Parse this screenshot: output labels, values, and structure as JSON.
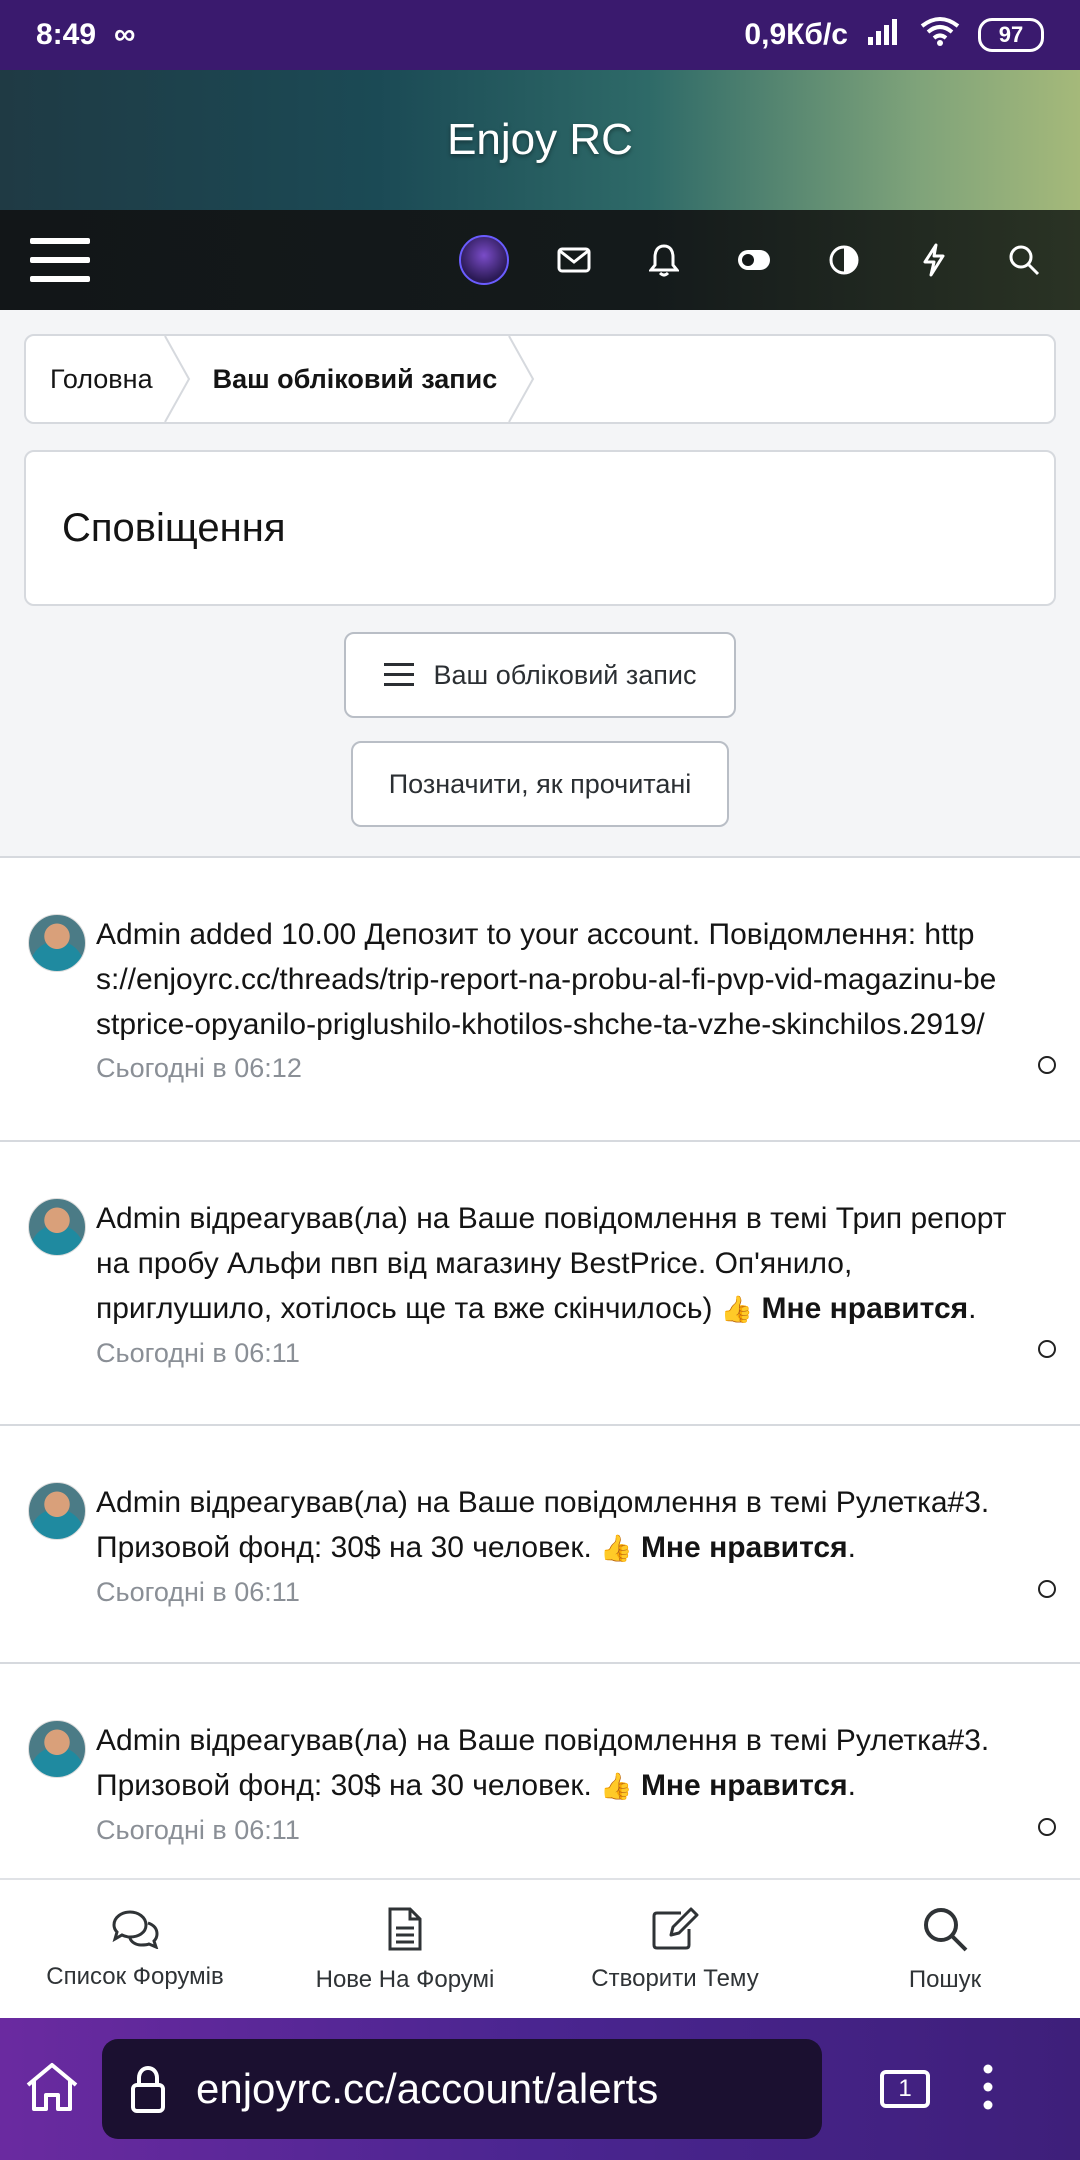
{
  "status_bar": {
    "time": "8:49",
    "infinity_icon": "∞",
    "network_speed": "0,9Кб/с",
    "battery": "97"
  },
  "header": {
    "site_title": "Enjoy RC"
  },
  "breadcrumb": {
    "home": "Головна",
    "current": "Ваш обліковий запис"
  },
  "page": {
    "title": "Сповіщення",
    "account_button": "Ваш обліковий запис",
    "mark_read_button": "Позначити, як прочитані"
  },
  "alerts": [
    {
      "text": "Admin added 10.00 Депозит to your account. Повідомлення: https://enjoyrc.cc/threads/trip-report-na-probu-al-fi-pvp-vid-magazinu-bestprice-opyanilo-priglushilo-khotilos-shche-ta-vzhe-skinchilos.2919/",
      "time": "Сьогодні в 06:12"
    },
    {
      "text": "Admin відреагував(ла) на Ваше повідомлення в темі Трип репорт на пробу Альфи пвп від магазину BestPrice. Оп'янило, приглушило, хотілось ще та вже скінчилось)",
      "reaction": "Мне нравится",
      "time": "Сьогодні в 06:11"
    },
    {
      "text": "Admin відреагував(ла) на Ваше повідомлення в темі Рулетка#3. Призовой фонд: 30$ на 30 человек.",
      "reaction": "Мне нравится",
      "time": "Сьогодні в 06:11"
    },
    {
      "text": "Admin відреагував(ла) на Ваше повідомлення в темі Рулетка#3. Призовой фонд: 30$ на 30 человек.",
      "reaction": "Мне нравится",
      "time": "Сьогодні в 06:11"
    }
  ],
  "forum_nav": [
    {
      "label": "Список Форумів",
      "icon": "chat-bubbles-icon"
    },
    {
      "label": "Нове На Форумі",
      "icon": "document-icon"
    },
    {
      "label": "Створити Тему",
      "icon": "edit-icon"
    },
    {
      "label": "Пошук",
      "icon": "search-icon"
    }
  ],
  "browser": {
    "url": "enjoyrc.cc/account/alerts",
    "tab_count": "1"
  }
}
